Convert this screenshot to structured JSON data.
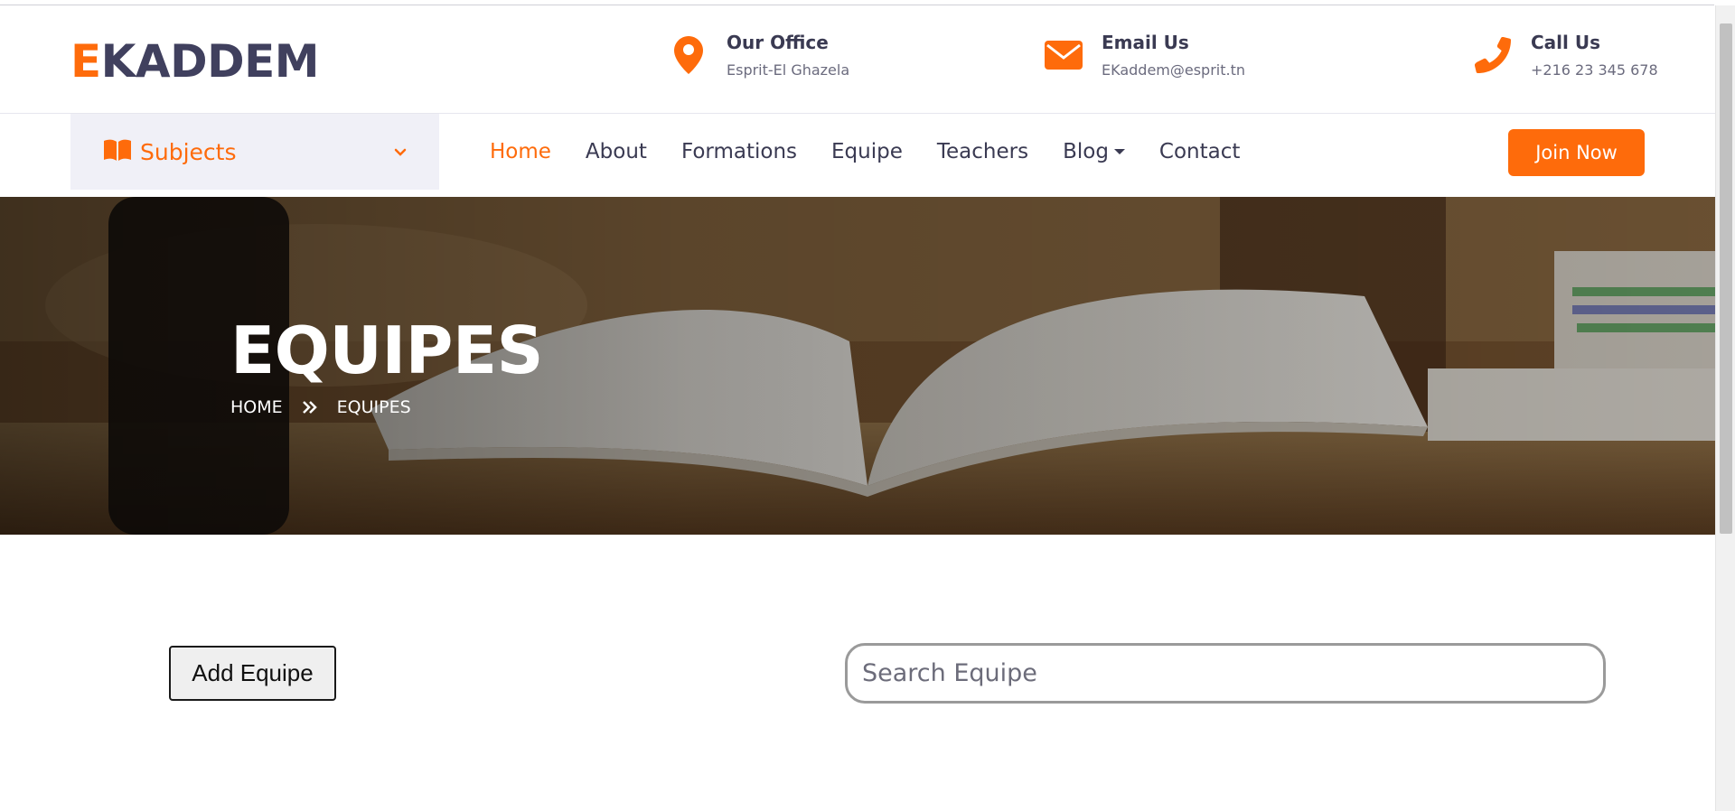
{
  "brand": {
    "logo_accent": "E",
    "logo_rest": "KADDEM",
    "accent_color": "#fe6b0b",
    "text_color": "#40405e"
  },
  "header": {
    "office": {
      "title": "Our Office",
      "value": "Esprit-El Ghazela",
      "icon": "map-pin-icon"
    },
    "email": {
      "title": "Email Us",
      "value": "EKaddem@esprit.tn",
      "icon": "envelope-icon"
    },
    "call": {
      "title": "Call Us",
      "value": "+216 23 345 678",
      "icon": "phone-icon"
    }
  },
  "nav": {
    "subjects_label": "Subjects",
    "items": [
      {
        "label": "Home",
        "active": true
      },
      {
        "label": "About"
      },
      {
        "label": "Formations"
      },
      {
        "label": "Equipe"
      },
      {
        "label": "Teachers"
      },
      {
        "label": "Blog",
        "dropdown": true
      },
      {
        "label": "Contact"
      }
    ],
    "join_label": "Join Now"
  },
  "hero": {
    "title": "EQUIPES",
    "breadcrumb": [
      "HOME",
      "EQUIPES"
    ]
  },
  "content": {
    "add_button": "Add Equipe",
    "search_placeholder": "Search Equipe"
  }
}
